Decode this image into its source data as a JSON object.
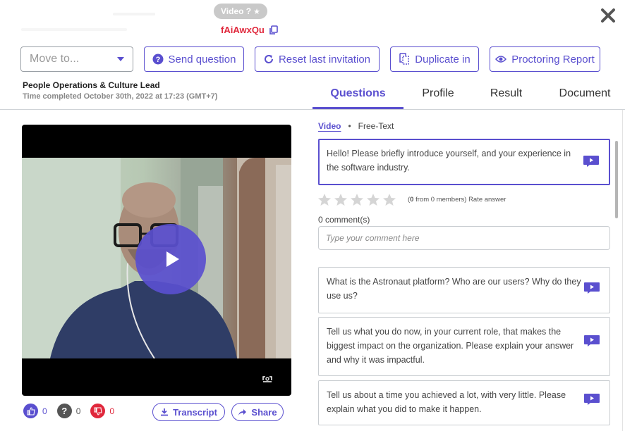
{
  "header": {
    "badge_label": "Video ?",
    "candidate_code": "fAiAwxQu"
  },
  "toolbar": {
    "move_placeholder": "Move to...",
    "send_question": "Send question",
    "reset_invitation": "Reset last invitation",
    "duplicate_in": "Duplicate in",
    "proctoring_report": "Proctoring Report"
  },
  "job": {
    "title": "People Operations & Culture Lead",
    "time_completed": "Time completed October 30th, 2022 at 17:23 (GMT+7)"
  },
  "tabs": [
    {
      "label": "Questions",
      "active": true
    },
    {
      "label": "Profile",
      "active": false
    },
    {
      "label": "Result",
      "active": false
    },
    {
      "label": "Document",
      "active": false
    }
  ],
  "subtabs": {
    "video": "Video",
    "separator": "•",
    "free_text": "Free-Text"
  },
  "questions": [
    {
      "text": "Hello! Please briefly introduce yourself, and your experience in the software industry.",
      "active": true
    },
    {
      "text": "What is the Astronaut platform? Who are our users? Why do they use us?",
      "active": false
    },
    {
      "text": "Tell us what you do now, in your current role, that makes the biggest impact on the organization. Please explain your answer and why it was impactful.",
      "active": false
    },
    {
      "text": "Tell us about a time you achieved a lot, with very little. Please explain what you did to make it happen.",
      "active": false
    }
  ],
  "rating": {
    "count": "0",
    "text_middle": " from 0 members) Rate answer",
    "stars_filled": 0,
    "stars_total": 5
  },
  "comments": {
    "count_label": "0 comment(s)",
    "placeholder": "Type your comment here"
  },
  "reactions": {
    "likes": "0",
    "unsure": "0",
    "dislikes": "0"
  },
  "video_actions": {
    "transcript": "Transcript",
    "share": "Share"
  },
  "colors": {
    "accent": "#5a4fcf",
    "code_red": "#e0283c",
    "like_blue": "#5a4fcf",
    "unsure_gray": "#555555",
    "dislike_red": "#e0283c"
  }
}
